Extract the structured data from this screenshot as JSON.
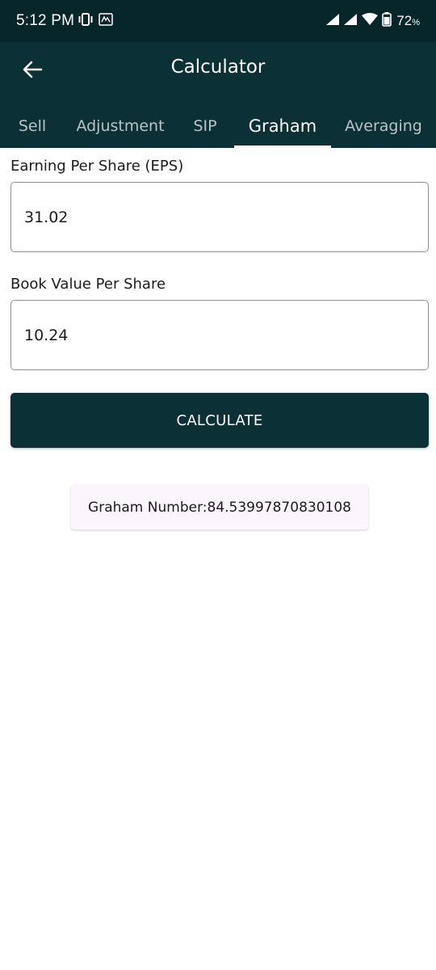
{
  "status_bar": {
    "time": "5:12 PM",
    "battery": "72",
    "battery_unit": "%"
  },
  "app_bar": {
    "title": "Calculator"
  },
  "tabs": [
    {
      "label": "Sell",
      "active": false
    },
    {
      "label": "Adjustment",
      "active": false
    },
    {
      "label": "SIP",
      "active": false
    },
    {
      "label": "Graham",
      "active": true
    },
    {
      "label": "Averaging",
      "active": false
    }
  ],
  "form": {
    "eps_label": "Earning Per Share (EPS)",
    "eps_value": "31.02",
    "bvps_label": "Book Value Per Share",
    "bvps_value": "10.24",
    "calculate_label": "CALCULATE"
  },
  "result": {
    "label": "Graham Number:",
    "value": "84.53997870830108"
  },
  "colors": {
    "primary": "#0b3035",
    "status_bar": "#06262a",
    "result_card": "#fbf5fc"
  }
}
